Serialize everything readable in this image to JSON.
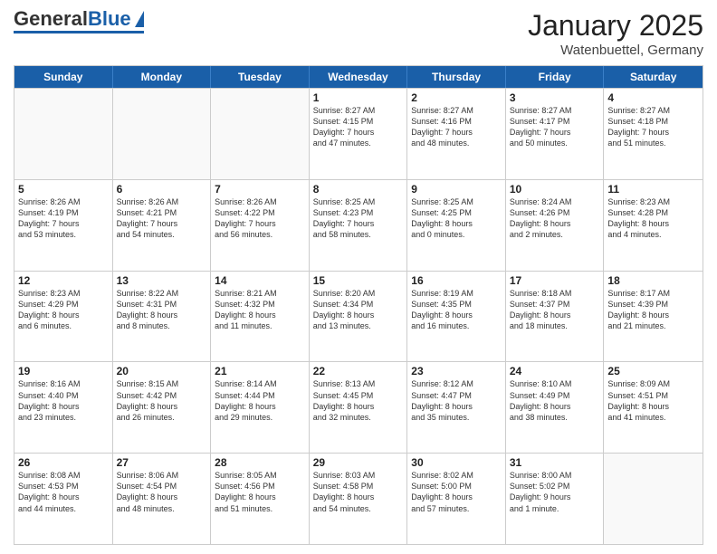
{
  "header": {
    "logo_general": "General",
    "logo_blue": "Blue",
    "title": "January 2025",
    "subtitle": "Watenbuettel, Germany"
  },
  "days_of_week": [
    "Sunday",
    "Monday",
    "Tuesday",
    "Wednesday",
    "Thursday",
    "Friday",
    "Saturday"
  ],
  "weeks": [
    [
      {
        "day": "",
        "text": ""
      },
      {
        "day": "",
        "text": ""
      },
      {
        "day": "",
        "text": ""
      },
      {
        "day": "1",
        "text": "Sunrise: 8:27 AM\nSunset: 4:15 PM\nDaylight: 7 hours\nand 47 minutes."
      },
      {
        "day": "2",
        "text": "Sunrise: 8:27 AM\nSunset: 4:16 PM\nDaylight: 7 hours\nand 48 minutes."
      },
      {
        "day": "3",
        "text": "Sunrise: 8:27 AM\nSunset: 4:17 PM\nDaylight: 7 hours\nand 50 minutes."
      },
      {
        "day": "4",
        "text": "Sunrise: 8:27 AM\nSunset: 4:18 PM\nDaylight: 7 hours\nand 51 minutes."
      }
    ],
    [
      {
        "day": "5",
        "text": "Sunrise: 8:26 AM\nSunset: 4:19 PM\nDaylight: 7 hours\nand 53 minutes."
      },
      {
        "day": "6",
        "text": "Sunrise: 8:26 AM\nSunset: 4:21 PM\nDaylight: 7 hours\nand 54 minutes."
      },
      {
        "day": "7",
        "text": "Sunrise: 8:26 AM\nSunset: 4:22 PM\nDaylight: 7 hours\nand 56 minutes."
      },
      {
        "day": "8",
        "text": "Sunrise: 8:25 AM\nSunset: 4:23 PM\nDaylight: 7 hours\nand 58 minutes."
      },
      {
        "day": "9",
        "text": "Sunrise: 8:25 AM\nSunset: 4:25 PM\nDaylight: 8 hours\nand 0 minutes."
      },
      {
        "day": "10",
        "text": "Sunrise: 8:24 AM\nSunset: 4:26 PM\nDaylight: 8 hours\nand 2 minutes."
      },
      {
        "day": "11",
        "text": "Sunrise: 8:23 AM\nSunset: 4:28 PM\nDaylight: 8 hours\nand 4 minutes."
      }
    ],
    [
      {
        "day": "12",
        "text": "Sunrise: 8:23 AM\nSunset: 4:29 PM\nDaylight: 8 hours\nand 6 minutes."
      },
      {
        "day": "13",
        "text": "Sunrise: 8:22 AM\nSunset: 4:31 PM\nDaylight: 8 hours\nand 8 minutes."
      },
      {
        "day": "14",
        "text": "Sunrise: 8:21 AM\nSunset: 4:32 PM\nDaylight: 8 hours\nand 11 minutes."
      },
      {
        "day": "15",
        "text": "Sunrise: 8:20 AM\nSunset: 4:34 PM\nDaylight: 8 hours\nand 13 minutes."
      },
      {
        "day": "16",
        "text": "Sunrise: 8:19 AM\nSunset: 4:35 PM\nDaylight: 8 hours\nand 16 minutes."
      },
      {
        "day": "17",
        "text": "Sunrise: 8:18 AM\nSunset: 4:37 PM\nDaylight: 8 hours\nand 18 minutes."
      },
      {
        "day": "18",
        "text": "Sunrise: 8:17 AM\nSunset: 4:39 PM\nDaylight: 8 hours\nand 21 minutes."
      }
    ],
    [
      {
        "day": "19",
        "text": "Sunrise: 8:16 AM\nSunset: 4:40 PM\nDaylight: 8 hours\nand 23 minutes."
      },
      {
        "day": "20",
        "text": "Sunrise: 8:15 AM\nSunset: 4:42 PM\nDaylight: 8 hours\nand 26 minutes."
      },
      {
        "day": "21",
        "text": "Sunrise: 8:14 AM\nSunset: 4:44 PM\nDaylight: 8 hours\nand 29 minutes."
      },
      {
        "day": "22",
        "text": "Sunrise: 8:13 AM\nSunset: 4:45 PM\nDaylight: 8 hours\nand 32 minutes."
      },
      {
        "day": "23",
        "text": "Sunrise: 8:12 AM\nSunset: 4:47 PM\nDaylight: 8 hours\nand 35 minutes."
      },
      {
        "day": "24",
        "text": "Sunrise: 8:10 AM\nSunset: 4:49 PM\nDaylight: 8 hours\nand 38 minutes."
      },
      {
        "day": "25",
        "text": "Sunrise: 8:09 AM\nSunset: 4:51 PM\nDaylight: 8 hours\nand 41 minutes."
      }
    ],
    [
      {
        "day": "26",
        "text": "Sunrise: 8:08 AM\nSunset: 4:53 PM\nDaylight: 8 hours\nand 44 minutes."
      },
      {
        "day": "27",
        "text": "Sunrise: 8:06 AM\nSunset: 4:54 PM\nDaylight: 8 hours\nand 48 minutes."
      },
      {
        "day": "28",
        "text": "Sunrise: 8:05 AM\nSunset: 4:56 PM\nDaylight: 8 hours\nand 51 minutes."
      },
      {
        "day": "29",
        "text": "Sunrise: 8:03 AM\nSunset: 4:58 PM\nDaylight: 8 hours\nand 54 minutes."
      },
      {
        "day": "30",
        "text": "Sunrise: 8:02 AM\nSunset: 5:00 PM\nDaylight: 8 hours\nand 57 minutes."
      },
      {
        "day": "31",
        "text": "Sunrise: 8:00 AM\nSunset: 5:02 PM\nDaylight: 9 hours\nand 1 minute."
      },
      {
        "day": "",
        "text": ""
      }
    ]
  ]
}
